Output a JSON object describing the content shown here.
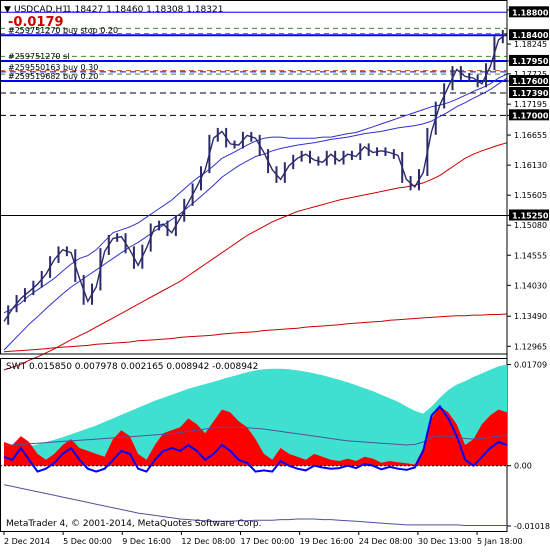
{
  "window": {
    "symbol_timeframe": "USDCAD,H1",
    "ohlc": "1.18427 1.18460 1.18308 1.18321",
    "profit": "-0.0179",
    "copyright": "MetaTrader 4, © 2001-2014, MetaQuotes Software Corp."
  },
  "colors": {
    "background": "#ffffff",
    "candles": "#2b2b6b",
    "order_line": "#0000ff",
    "ma_blue": "#3030d0",
    "ma_red": "#cc0000",
    "swt_fill_cyan": "#40e0d0",
    "swt_fill_red": "#ff0000",
    "swt_line": "#0000ff",
    "profit": "#cc0000"
  },
  "chart_data": [
    {
      "type": "line",
      "name": "price",
      "x_labels": [
        "2 Dec 2014",
        "5 Dec 00:00",
        "9 Dec 16:00",
        "12 Dec 08:00",
        "17 Dec 00:00",
        "19 Dec 16:00",
        "24 Dec 08:00",
        "30 Dec 13:00",
        "5 Jan 18:00"
      ],
      "y_ticks": [
        1.1884,
        1.18245,
        1.1795,
        1.17725,
        1.176,
        1.17195,
        1.17,
        1.16655,
        1.1613,
        1.15605,
        1.1525,
        1.1508,
        1.14555,
        1.1403,
        1.1349,
        1.12965
      ],
      "y_tick_labels": [
        "1.18800",
        "1.18245",
        "1.17950",
        "1.17725",
        "1.17600",
        "1.17195",
        "1.17000",
        "1.16655",
        "1.16130",
        "1.15605",
        "1.15250",
        "1.15080",
        "1.14555",
        "1.14030",
        "1.13490",
        "1.12965"
      ],
      "highlighted_levels": [
        "1.18800",
        "1.18400",
        "1.17950",
        "1.17600",
        "1.17390",
        "1.17000",
        "1.15250"
      ],
      "ylim": [
        1.1283,
        1.1898
      ],
      "price_close": [
        1.134,
        1.1362,
        1.138,
        1.1392,
        1.1405,
        1.1422,
        1.1448,
        1.1465,
        1.146,
        1.1415,
        1.1375,
        1.14,
        1.1462,
        1.1485,
        1.1488,
        1.1465,
        1.1438,
        1.1468,
        1.1505,
        1.151,
        1.1495,
        1.152,
        1.1548,
        1.1575,
        1.1605,
        1.166,
        1.1672,
        1.165,
        1.1648,
        1.1665,
        1.166,
        1.1635,
        1.1605,
        1.1588,
        1.1612,
        1.1625,
        1.1632,
        1.1622,
        1.1618,
        1.1632,
        1.162,
        1.1632,
        1.1628,
        1.1645,
        1.1635,
        1.1638,
        1.1635,
        1.163,
        1.1588,
        1.1575,
        1.16,
        1.1672,
        1.1718,
        1.175,
        1.178,
        1.1768,
        1.1765,
        1.1755,
        1.1785,
        1.1832,
        1.1843
      ],
      "order_lines": [
        {
          "label": "#259751270 buy stop 0.20",
          "price": 1.184,
          "style": "solid"
        },
        {
          "label": "#259751270 sl",
          "price": 1.1795,
          "style": "solid"
        },
        {
          "label": "#259550163 buy 0.30",
          "price": 1.1776,
          "style": "dashed"
        },
        {
          "label": "#259519682 buy 0.20",
          "price": 1.176,
          "style": "solid"
        }
      ],
      "extra_levels": [
        {
          "price": 1.188,
          "style": "solid-thin"
        },
        {
          "price": 1.1739,
          "style": "dashed-black"
        },
        {
          "price": 1.17,
          "style": "dashed-black"
        },
        {
          "price": 1.1525,
          "style": "solid-black"
        }
      ],
      "ma_blue_1": [
        1.1355,
        1.1362,
        1.1372,
        1.1385,
        1.1395,
        1.1405,
        1.1415,
        1.1428,
        1.144,
        1.145,
        1.1455,
        1.1465,
        1.148,
        1.1495,
        1.15,
        1.1505,
        1.1512,
        1.1522,
        1.1532,
        1.1542,
        1.1552,
        1.1565,
        1.1578,
        1.159,
        1.16,
        1.1612,
        1.1625,
        1.1632,
        1.164,
        1.1648,
        1.1655,
        1.166,
        1.1662,
        1.1662,
        1.166,
        1.166,
        1.166,
        1.166,
        1.1662,
        1.1662,
        1.1665,
        1.1668,
        1.167,
        1.1675,
        1.168,
        1.1685,
        1.169,
        1.1695,
        1.17,
        1.1705,
        1.171,
        1.1715,
        1.1718,
        1.1722,
        1.1728,
        1.1735,
        1.1742,
        1.1748,
        1.1755,
        1.1765,
        1.1772
      ],
      "ma_blue_2": [
        1.129,
        1.1305,
        1.132,
        1.1335,
        1.1348,
        1.1362,
        1.1375,
        1.1388,
        1.14,
        1.141,
        1.142,
        1.143,
        1.144,
        1.145,
        1.146,
        1.147,
        1.1478,
        1.1488,
        1.1498,
        1.1508,
        1.1518,
        1.1528,
        1.154,
        1.1552,
        1.1565,
        1.1578,
        1.1592,
        1.1602,
        1.1612,
        1.162,
        1.1628,
        1.1632,
        1.1638,
        1.1642,
        1.1645,
        1.1648,
        1.165,
        1.1652,
        1.1655,
        1.1658,
        1.166,
        1.1662,
        1.1665,
        1.1668,
        1.167,
        1.1672,
        1.1675,
        1.1678,
        1.168,
        1.1682,
        1.1685,
        1.169,
        1.1698,
        1.1706,
        1.1715,
        1.1722,
        1.173,
        1.1737,
        1.1745,
        1.1755,
        1.1765
      ],
      "ma_red": [
        1.1255,
        1.126,
        1.1265,
        1.1272,
        1.1278,
        1.1285,
        1.1292,
        1.13,
        1.1308,
        1.1315,
        1.1322,
        1.133,
        1.1338,
        1.1346,
        1.1354,
        1.1362,
        1.137,
        1.1378,
        1.1386,
        1.1394,
        1.1402,
        1.141,
        1.142,
        1.143,
        1.144,
        1.145,
        1.146,
        1.147,
        1.148,
        1.149,
        1.1498,
        1.1506,
        1.1514,
        1.152,
        1.1526,
        1.1532,
        1.1536,
        1.154,
        1.1544,
        1.1548,
        1.1552,
        1.1555,
        1.1558,
        1.1561,
        1.1564,
        1.1567,
        1.157,
        1.1573,
        1.1575,
        1.1578,
        1.1582,
        1.1588,
        1.1595,
        1.1605,
        1.1615,
        1.1625,
        1.1632,
        1.1638,
        1.1643,
        1.1648,
        1.1652
      ],
      "ma_red_lower": [
        1.1287,
        1.1288,
        1.1289,
        1.129,
        1.1291,
        1.1292,
        1.1294,
        1.1295,
        1.1296,
        1.1297,
        1.1298,
        1.13,
        1.1301,
        1.1302,
        1.1303,
        1.1304,
        1.1306,
        1.1307,
        1.1308,
        1.1309,
        1.131,
        1.1312,
        1.1313,
        1.1314,
        1.1315,
        1.1316,
        1.1318,
        1.1319,
        1.132,
        1.1321,
        1.1322,
        1.1324,
        1.1325,
        1.1326,
        1.1327,
        1.1328,
        1.133,
        1.1331,
        1.1332,
        1.1333,
        1.1334,
        1.1336,
        1.1337,
        1.1338,
        1.1339,
        1.134,
        1.1342,
        1.1343,
        1.1344,
        1.1345,
        1.1346,
        1.1347,
        1.1348,
        1.1349,
        1.135,
        1.135,
        1.1351,
        1.1351,
        1.1352,
        1.1352,
        1.1353
      ]
    },
    {
      "type": "area",
      "name": "swt",
      "header": "SWT 0.015850 0.007978 0.002165 0.008942 -0.008942",
      "y_tick_labels": [
        "0.01709",
        "0.00",
        "-0.010182"
      ],
      "ylim": [
        -0.0112,
        0.0182
      ],
      "upper_band": [
        0.0025,
        0.0028,
        0.003,
        0.0033,
        0.0036,
        0.004,
        0.0044,
        0.0048,
        0.0053,
        0.0058,
        0.0063,
        0.0068,
        0.0074,
        0.008,
        0.0086,
        0.0092,
        0.0098,
        0.0104,
        0.011,
        0.0115,
        0.012,
        0.0125,
        0.013,
        0.0134,
        0.0138,
        0.0142,
        0.0146,
        0.015,
        0.0154,
        0.0158,
        0.0161,
        0.0163,
        0.0164,
        0.0164,
        0.0163,
        0.0161,
        0.0159,
        0.0156,
        0.0153,
        0.0149,
        0.0145,
        0.0141,
        0.0136,
        0.0131,
        0.0126,
        0.012,
        0.0114,
        0.0108,
        0.01,
        0.0093,
        0.0088,
        0.01,
        0.0115,
        0.0128,
        0.0137,
        0.0143,
        0.015,
        0.0156,
        0.0162,
        0.0168,
        0.0171
      ],
      "red_area": [
        0.004,
        0.0035,
        0.005,
        0.004,
        0.002,
        0.001,
        0.002,
        0.0035,
        0.0045,
        0.003,
        0.0025,
        0.002,
        0.0015,
        0.0045,
        0.006,
        0.005,
        0.002,
        0.001,
        0.0035,
        0.0055,
        0.006,
        0.0065,
        0.008,
        0.007,
        0.0055,
        0.0075,
        0.0095,
        0.009,
        0.0075,
        0.0065,
        0.0045,
        0.002,
        0.001,
        0.003,
        0.002,
        0.0015,
        0.001,
        0.002,
        0.0015,
        0.001,
        0.0008,
        0.0012,
        0.0008,
        0.0015,
        0.0012,
        0.0005,
        0.0008,
        0.0006,
        0.0004,
        0.0002,
        0.003,
        0.008,
        0.01,
        0.009,
        0.007,
        0.0035,
        0.0045,
        0.007,
        0.0085,
        0.0095,
        0.009
      ],
      "signal_line": [
        0.0015,
        0.001,
        0.003,
        0.001,
        -0.001,
        -0.0005,
        0.0005,
        0.002,
        0.003,
        0.001,
        -0.0005,
        -0.001,
        -0.0005,
        0.001,
        0.0025,
        0.002,
        -0.0005,
        -0.001,
        0.001,
        0.0025,
        0.003,
        0.0025,
        0.0035,
        0.0025,
        0.001,
        0.002,
        0.0035,
        0.0025,
        0.001,
        0.0005,
        -0.001,
        -0.0008,
        -0.001,
        0.0008,
        0.0,
        -0.0005,
        -0.0008,
        0.0,
        -0.0003,
        -0.0005,
        -0.0004,
        0.0,
        -0.0004,
        0.0003,
        0.0,
        -0.0006,
        -0.0002,
        -0.0005,
        -0.0007,
        -0.0003,
        0.0025,
        0.0085,
        0.01,
        0.008,
        0.005,
        0.001,
        0.0,
        0.0015,
        0.003,
        0.004,
        0.0035
      ],
      "mid_band": [
        0.0034,
        0.0035,
        0.0036,
        0.0037,
        0.0038,
        0.0039,
        0.004,
        0.0041,
        0.0042,
        0.0043,
        0.0044,
        0.0045,
        0.0046,
        0.0047,
        0.0048,
        0.0049,
        0.005,
        0.0051,
        0.0052,
        0.0053,
        0.0054,
        0.0056,
        0.0058,
        0.006,
        0.0062,
        0.0064,
        0.0065,
        0.0065,
        0.0065,
        0.0064,
        0.0063,
        0.0062,
        0.006,
        0.0058,
        0.0056,
        0.0054,
        0.0052,
        0.005,
        0.0048,
        0.0046,
        0.0044,
        0.0042,
        0.0041,
        0.004,
        0.0039,
        0.0038,
        0.0037,
        0.0036,
        0.0035,
        0.0036,
        0.004,
        0.0048,
        0.005,
        0.005,
        0.0048,
        0.0046,
        0.0045,
        0.0046,
        0.0048,
        0.005,
        0.0052
      ],
      "lower_band": [
        -0.0032,
        -0.0035,
        -0.0038,
        -0.0041,
        -0.0044,
        -0.0047,
        -0.005,
        -0.0053,
        -0.0056,
        -0.0059,
        -0.0062,
        -0.0065,
        -0.0068,
        -0.0071,
        -0.0074,
        -0.0077,
        -0.008,
        -0.0082,
        -0.0084,
        -0.0086,
        -0.0088,
        -0.009,
        -0.0091,
        -0.0092,
        -0.0093,
        -0.0094,
        -0.0094,
        -0.0094,
        -0.0093,
        -0.0093,
        -0.0092,
        -0.0092,
        -0.0092,
        -0.0091,
        -0.0091,
        -0.009,
        -0.009,
        -0.009,
        -0.0091,
        -0.0091,
        -0.0092,
        -0.0093,
        -0.0094,
        -0.0095,
        -0.0096,
        -0.0097,
        -0.0098,
        -0.0099,
        -0.01,
        -0.01,
        -0.01,
        -0.01,
        -0.01,
        -0.01,
        -0.01,
        -0.0101,
        -0.0101,
        -0.0101,
        -0.0101,
        -0.0101,
        -0.0101
      ]
    }
  ]
}
